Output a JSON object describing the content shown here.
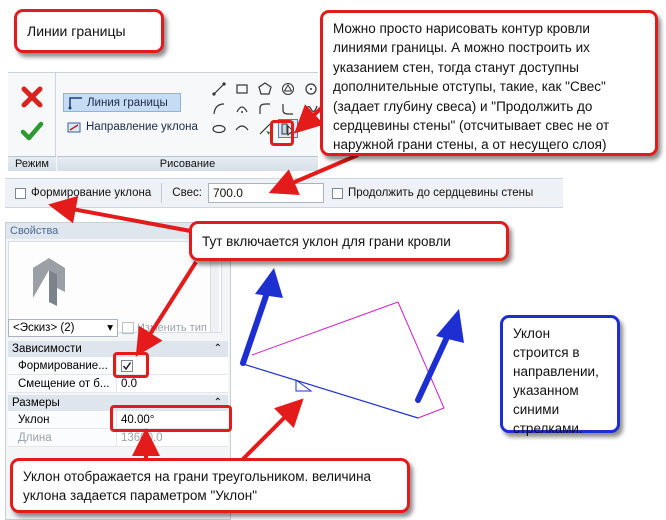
{
  "callouts": {
    "boundary_lines": "Линии границы",
    "contour": "Можно просто нарисовать контур кровли линиями границы. А можно построить их указанием стен, тогда станут доступны дополнительные отступы, такие, как \"Свес\" (задает глубину свеса) и \"Продолжить до сердцевины стены\" (отсчитывает свес не от наружной грани стены, а от несущего слоя)",
    "slope_toggle": "Тут включается уклон для грани кровли",
    "slope_direction": "Уклон строится в направлении, указанном синими стрелками.",
    "slope_triangle": "Уклон отображается на грани треугольником. величина уклона задается параметром \"Уклон\""
  },
  "ribbon": {
    "mode_label": "Режим",
    "draw_label": "Рисование",
    "boundary_line_label": "Линия границы",
    "slope_arrow_label": "Направление уклона"
  },
  "options_bar": {
    "define_slope_label": "Формирование уклона",
    "define_slope_checked": false,
    "overhang_label": "Свес:",
    "overhang_value": "700.0",
    "extend_to_core_label": "Продолжить до сердцевины стены",
    "extend_to_core_checked": false
  },
  "properties": {
    "title": "Свойства",
    "type_selector": "<Эскиз> (2)",
    "edit_type_label": "Изменить тип",
    "groups": {
      "constraints": "Зависимости",
      "dimensions": "Размеры"
    },
    "rows": {
      "define_slope": {
        "label": "Формирование...",
        "checked": true
      },
      "offset": {
        "label": "Смещение от б...",
        "value": "0.0"
      },
      "slope": {
        "label": "Уклон",
        "value": "40.00°"
      },
      "length": {
        "label": "Длина",
        "value": "13600.0"
      }
    }
  },
  "colors": {
    "callout_red": "#e31b1b",
    "callout_blue": "#1d2fd0",
    "boundary_line": "#d020c8",
    "slope_arrow": "#1d2fd0"
  }
}
